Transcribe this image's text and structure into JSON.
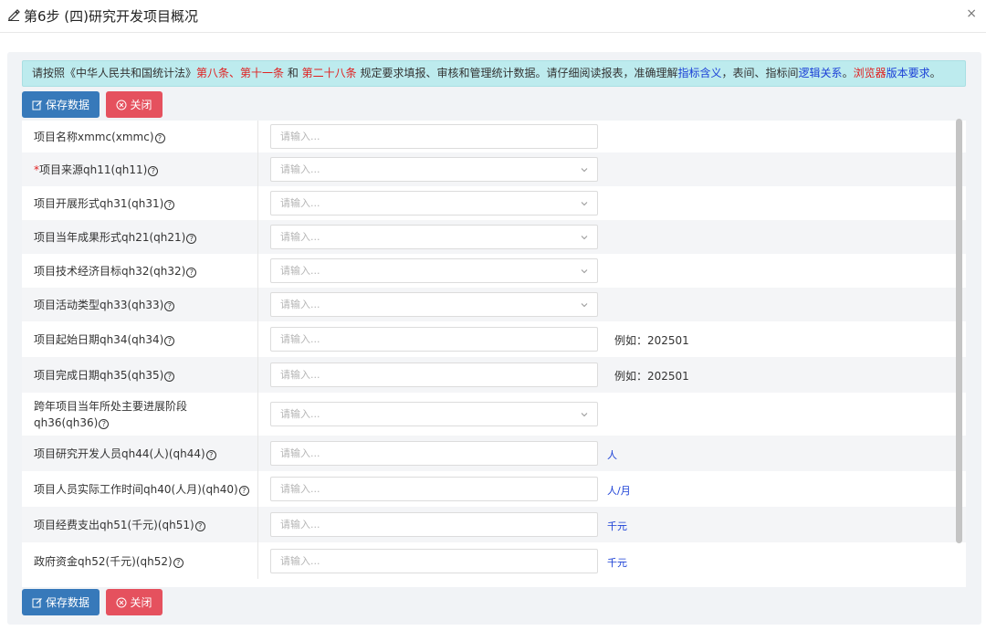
{
  "window": {
    "title": "第6步 (四)研究开发项目概况",
    "close": "×"
  },
  "notice": {
    "p1": "请按照《中华人民共和国统计法》",
    "p2": "第八条、第十一条",
    "p3": " 和 ",
    "p4": "第二十八条",
    "p5": " 规定要求填报、审核和管理统计数据。请仔细阅读报表，准确理解",
    "p6": "指标含义",
    "p7": "，表间、指标间",
    "p8": "逻辑关系",
    "p9": "。",
    "p10": "浏览器",
    "p11": "版本要求",
    "p12": "。"
  },
  "buttons": {
    "save": "保存数据",
    "close": "关闭"
  },
  "form": {
    "placeholder": "请输入...",
    "rows": [
      {
        "label": "项目名称xmmc(xmmc)",
        "required": false,
        "type": "input"
      },
      {
        "label": "项目来源qh11(qh11)",
        "required": true,
        "type": "select"
      },
      {
        "label": "项目开展形式qh31(qh31)",
        "required": false,
        "type": "select"
      },
      {
        "label": "项目当年成果形式qh21(qh21)",
        "required": false,
        "type": "select"
      },
      {
        "label": "项目技术经济目标qh32(qh32)",
        "required": false,
        "type": "select"
      },
      {
        "label": "项目活动类型qh33(qh33)",
        "required": false,
        "type": "select"
      },
      {
        "label": "项目起始日期qh34(qh34)",
        "required": false,
        "type": "input",
        "hint": "例如：202501"
      },
      {
        "label": "项目完成日期qh35(qh35)",
        "required": false,
        "type": "input",
        "hint": "例如：202501"
      },
      {
        "label_line1": "跨年项目当年所处主要进展阶段",
        "label_line2": "qh36(qh36)",
        "required": false,
        "type": "select"
      },
      {
        "label": "项目研究开发人员qh44(人)(qh44)",
        "required": false,
        "type": "input",
        "unit": "人"
      },
      {
        "label": "项目人员实际工作时间qh40(人月)(qh40)",
        "required": false,
        "type": "input",
        "unit": "人/月"
      },
      {
        "label": "项目经费支出qh51(千元)(qh51)",
        "required": false,
        "type": "input",
        "unit": "千元"
      },
      {
        "label": "政府资金qh52(千元)(qh52)",
        "required": false,
        "type": "input",
        "unit": "千元"
      }
    ]
  },
  "colors": {
    "save": "#3779ba",
    "close": "#e5515e",
    "notice_bg": "#bdebee",
    "red": "#e01f1f",
    "blue": "#1a3fd6"
  },
  "icons": {
    "title": "edit-icon",
    "save": "edit-icon",
    "close": "circle-x-icon",
    "select": "chevron-down-icon",
    "help": "question-circle-icon"
  }
}
